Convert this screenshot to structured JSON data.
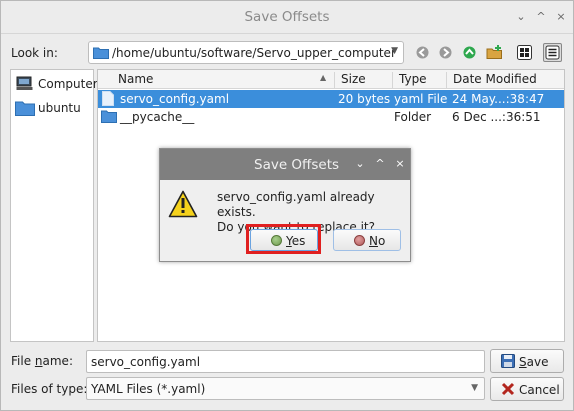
{
  "window": {
    "title": "Save Offsets",
    "controls": {
      "minimize": "⌄",
      "maximize": "^",
      "close": "×"
    }
  },
  "toolbar": {
    "look_in_label": "Look in:",
    "path": "/home/ubuntu/software/Servo_upper_computer",
    "nav_icons": [
      "back-icon",
      "forward-icon",
      "parent-directory-icon",
      "new-folder-icon",
      "list-view-icon",
      "detail-view-icon"
    ]
  },
  "sidebar": {
    "items": [
      {
        "label": "Computer",
        "icon": "computer-icon"
      },
      {
        "label": "ubuntu",
        "icon": "folder-icon"
      }
    ]
  },
  "filelist": {
    "columns": [
      "Name",
      "Size",
      "Type",
      "Date Modified"
    ],
    "sort_indicator": "▲",
    "rows": [
      {
        "name": "servo_config.yaml",
        "size": "20 bytes",
        "type": "yaml File",
        "date": "24 May...:38:47",
        "selected": true,
        "icon": "file-icon"
      },
      {
        "name": "__pycache__",
        "size": "",
        "type": "Folder",
        "date": "6 Dec ...:36:51",
        "selected": false,
        "icon": "folder-icon"
      }
    ]
  },
  "bottom": {
    "file_name_label_pre": "File ",
    "file_name_label_u": "n",
    "file_name_label_post": "ame:",
    "file_name_value": "servo_config.yaml",
    "files_of_type_label": "Files of type:",
    "files_of_type_value": "YAML Files (*.yaml)",
    "save_label_u": "S",
    "save_label_rest": "ave",
    "cancel_label": "Cancel"
  },
  "dialog": {
    "title": "Save Offsets",
    "message_line1": "servo_config.yaml already exists.",
    "message_line2": "Do you want to replace it?",
    "yes_u": "Y",
    "yes_rest": "es",
    "no_u": "N",
    "no_rest": "o",
    "controls": {
      "minimize": "⌄",
      "maximize": "^",
      "close": "×"
    }
  },
  "colors": {
    "selection": "#3b8edb",
    "highlight_border": "#e02020",
    "dialog_titlebar": "#7f7f7f"
  }
}
